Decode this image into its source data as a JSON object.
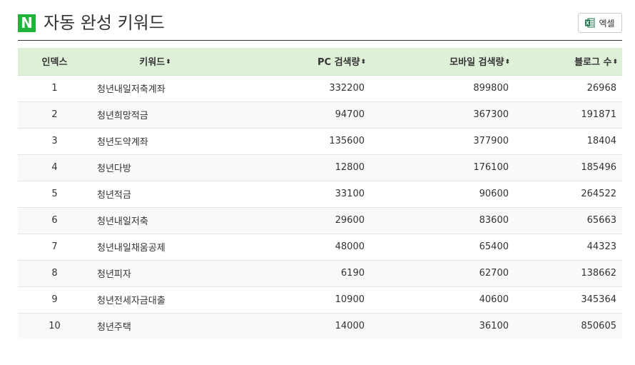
{
  "header": {
    "logo_letter": "N",
    "title": "자동 완성 키워드",
    "excel_label": "엑셀"
  },
  "colors": {
    "logo_green": "#1fb33b",
    "table_header_bg": "#dff0d8",
    "excel_green": "#1e7145"
  },
  "table": {
    "columns": [
      {
        "label": "인덱스",
        "sortable": false
      },
      {
        "label": "키워드",
        "sortable": true
      },
      {
        "label": "PC 검색량",
        "sortable": true
      },
      {
        "label": "모바일 검색량",
        "sortable": true
      },
      {
        "label": "블로그 수",
        "sortable": true
      }
    ],
    "sort_icon": "⬍",
    "rows": [
      {
        "index": "1",
        "keyword": "청년내일저축계좌",
        "pc": "332200",
        "mobile": "899800",
        "blog": "26968"
      },
      {
        "index": "2",
        "keyword": "청년희망적금",
        "pc": "94700",
        "mobile": "367300",
        "blog": "191871"
      },
      {
        "index": "3",
        "keyword": "청년도약계좌",
        "pc": "135600",
        "mobile": "377900",
        "blog": "18404"
      },
      {
        "index": "4",
        "keyword": "청년다방",
        "pc": "12800",
        "mobile": "176100",
        "blog": "185496"
      },
      {
        "index": "5",
        "keyword": "청년적금",
        "pc": "33100",
        "mobile": "90600",
        "blog": "264522"
      },
      {
        "index": "6",
        "keyword": "청년내일저축",
        "pc": "29600",
        "mobile": "83600",
        "blog": "65663"
      },
      {
        "index": "7",
        "keyword": "청년내일채움공제",
        "pc": "48000",
        "mobile": "65400",
        "blog": "44323"
      },
      {
        "index": "8",
        "keyword": "청년피자",
        "pc": "6190",
        "mobile": "62700",
        "blog": "138662"
      },
      {
        "index": "9",
        "keyword": "청년전세자금대출",
        "pc": "10900",
        "mobile": "40600",
        "blog": "345364"
      },
      {
        "index": "10",
        "keyword": "청년주택",
        "pc": "14000",
        "mobile": "36100",
        "blog": "850605"
      }
    ]
  }
}
